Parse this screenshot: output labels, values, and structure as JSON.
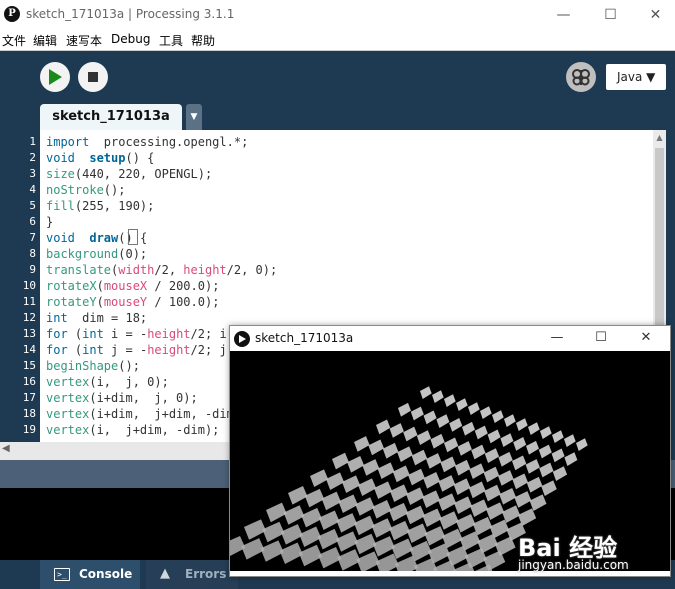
{
  "window": {
    "title": "sketch_171013a | Processing 3.1.1",
    "icon_glyph": "P"
  },
  "menu": [
    "文件",
    "编辑",
    "速写本",
    "Debug",
    "工具",
    "帮助"
  ],
  "toolbar": {
    "mode": "Java ▼"
  },
  "tabs": [
    {
      "label": "sketch_171013a",
      "active": true
    }
  ],
  "tab_menu_glyph": "▼",
  "editor": {
    "line_numbers": [
      "1",
      "2",
      "3",
      "4",
      "5",
      "6",
      "7",
      "8",
      "9",
      "10",
      "11",
      "12",
      "13",
      "14",
      "15",
      "16",
      "17",
      "18",
      "19"
    ],
    "lines": [
      [
        [
          "kw2",
          "import"
        ],
        [
          "",
          "  processing.opengl.*;"
        ]
      ],
      [
        [
          "kw2",
          "void"
        ],
        [
          "",
          "  "
        ],
        [
          "fn",
          "setup"
        ],
        [
          "",
          "() {"
        ]
      ],
      [
        [
          "kw1",
          "size"
        ],
        [
          "",
          "(440, 220, OPENGL);"
        ]
      ],
      [
        [
          "kw1",
          "noStroke"
        ],
        [
          "",
          "();"
        ]
      ],
      [
        [
          "kw1",
          "fill"
        ],
        [
          "",
          "(255, 190);"
        ]
      ],
      [
        [
          "",
          "}"
        ]
      ],
      [
        [
          "kw2",
          "void"
        ],
        [
          "",
          "  "
        ],
        [
          "fn",
          "draw"
        ],
        [
          "",
          "() {"
        ]
      ],
      [
        [
          "kw1",
          "background"
        ],
        [
          "",
          "(0);"
        ]
      ],
      [
        [
          "kw1",
          "translate"
        ],
        [
          "",
          "("
        ],
        [
          "var",
          "width"
        ],
        [
          "",
          "/2, "
        ],
        [
          "var",
          "height"
        ],
        [
          "",
          "/2, 0);"
        ]
      ],
      [
        [
          "kw1",
          "rotateX"
        ],
        [
          "",
          "("
        ],
        [
          "var",
          "mouseX"
        ],
        [
          "",
          " / 200.0);"
        ]
      ],
      [
        [
          "kw1",
          "rotateY"
        ],
        [
          "",
          "("
        ],
        [
          "var",
          "mouseY"
        ],
        [
          "",
          " / 100.0);"
        ]
      ],
      [
        [
          "kw2",
          "int"
        ],
        [
          "",
          "  dim = 18;"
        ]
      ],
      [
        [
          "kw2",
          "for"
        ],
        [
          "",
          " ("
        ],
        [
          "kw2",
          "int"
        ],
        [
          "",
          " i = -"
        ],
        [
          "var",
          "height"
        ],
        [
          "",
          "/2; i"
        ]
      ],
      [
        [
          "kw2",
          "for"
        ],
        [
          "",
          " ("
        ],
        [
          "kw2",
          "int"
        ],
        [
          "",
          " j = -"
        ],
        [
          "var",
          "height"
        ],
        [
          "",
          "/2; j"
        ]
      ],
      [
        [
          "kw1",
          "beginShape"
        ],
        [
          "",
          "();"
        ]
      ],
      [
        [
          "kw1",
          "vertex"
        ],
        [
          "",
          "(i,  j, 0);"
        ]
      ],
      [
        [
          "kw1",
          "vertex"
        ],
        [
          "",
          "(i+dim,  j, 0);"
        ]
      ],
      [
        [
          "kw1",
          "vertex"
        ],
        [
          "",
          "(i+dim,  j+dim, -dim)"
        ]
      ],
      [
        [
          "kw1",
          "vertex"
        ],
        [
          "",
          "(i,  j+dim, -dim);"
        ]
      ]
    ]
  },
  "console_tabs": {
    "console": "Console",
    "errors": "Errors"
  },
  "sketch_window": {
    "title": "sketch_171013a"
  },
  "watermark": {
    "logo": "Bai 经验",
    "url": "jingyan.baidu.com"
  }
}
